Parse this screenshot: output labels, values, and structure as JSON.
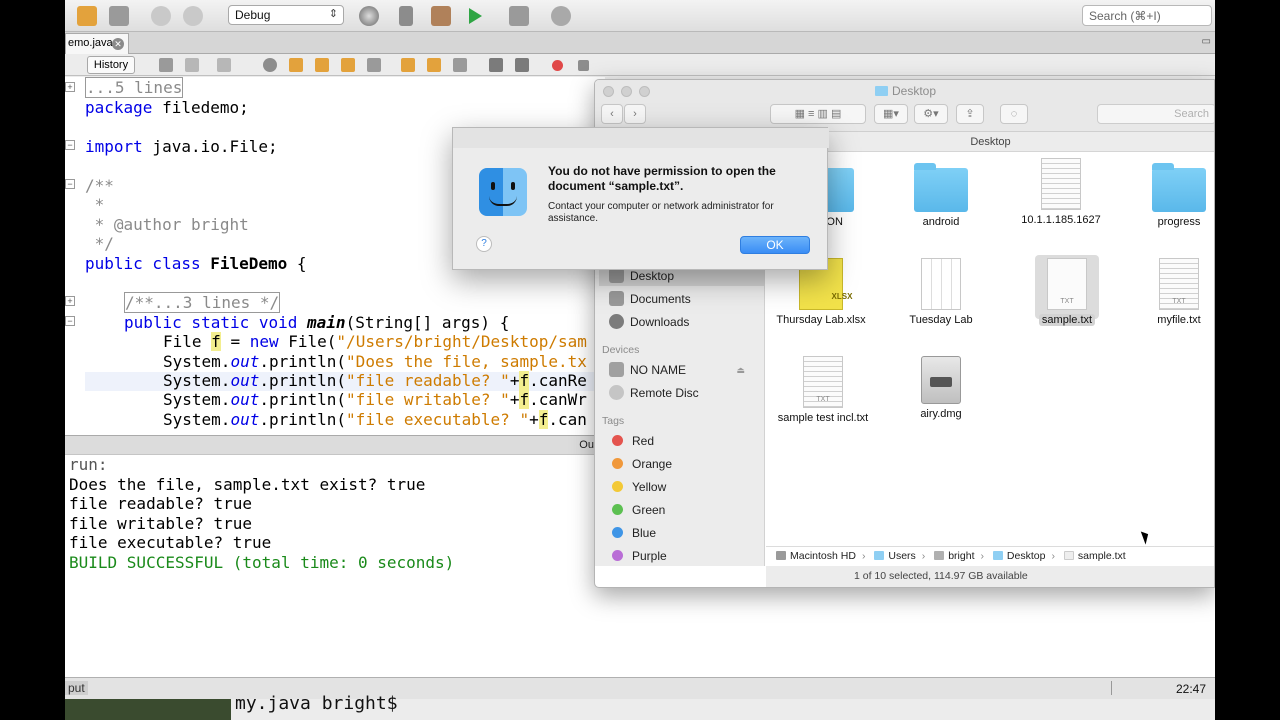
{
  "toolbar": {
    "config_select": "Debug",
    "search_placeholder": "Search (⌘+I)"
  },
  "editor": {
    "tab_label": "emo.java",
    "history_label": "History",
    "code": {
      "l1": "...5 lines",
      "l2_kw": "package",
      "l2_rest": " filedemo;",
      "l4_kw": "import",
      "l4_rest": " java.io.File;",
      "l6": "/**",
      "l7": " *",
      "l8": " * @author bright",
      "l9": " */",
      "l10_kw": "public class",
      "l10_name": "FileDemo",
      "l10_rest": " {",
      "l12": "/**...3 lines */",
      "l13_kw": "public static void",
      "l13_name": "main",
      "l13_rest": "(String[] args) {",
      "l14_a": "File ",
      "l14_var": "f",
      "l14_b": " = ",
      "l14_kw": "new",
      "l14_c": " File(",
      "l14_str": "\"/Users/bright/Desktop/sam",
      "l15_a": "System.",
      "l15_out": "out",
      "l15_b": ".println(",
      "l15_str": "\"Does the file, sample.tx",
      "l16_a": "System.",
      "l16_out": "out",
      "l16_b": ".println(",
      "l16_str": "\"file readable? \"",
      "l16_c": "+",
      "l16_var": "f",
      "l16_d": ".canRe",
      "l17_a": "System.",
      "l17_out": "out",
      "l17_b": ".println(",
      "l17_str": "\"file writable? \"",
      "l17_c": "+",
      "l17_var": "f",
      "l17_d": ".canWr",
      "l18_a": "System.",
      "l18_out": "out",
      "l18_b": ".println(",
      "l18_str": "\"file executable? \"",
      "l18_c": "+",
      "l18_var": "f",
      "l18_d": ".can"
    }
  },
  "output": {
    "header": "Out",
    "lines": [
      "run:",
      "Does the file, sample.txt exist? true",
      "file readable? true",
      "file writable? true",
      "file executable? true",
      "BUILD SUCCESSFUL (total time: 0 seconds)"
    ]
  },
  "status": {
    "left_label": "put",
    "time": "22:47",
    "terminal_peek": "my.java bright$"
  },
  "finder": {
    "title": "Desktop",
    "search_placeholder": "Search",
    "path_header": "Desktop",
    "sidebar": {
      "items": [
        "Desktop",
        "Documents",
        "Downloads"
      ],
      "devices_head": "Devices",
      "devices": [
        "NO NAME",
        "Remote Disc"
      ],
      "tags_head": "Tags",
      "tags": [
        {
          "name": "Red",
          "color": "#e4544e"
        },
        {
          "name": "Orange",
          "color": "#f0983b"
        },
        {
          "name": "Yellow",
          "color": "#f3c936"
        },
        {
          "name": "Green",
          "color": "#5cc051"
        },
        {
          "name": "Blue",
          "color": "#3f95e6"
        },
        {
          "name": "Purple",
          "color": "#b96dd6"
        }
      ]
    },
    "files": {
      "f1": "ANON",
      "f2": "android",
      "f3": "10.1.1.185.1627",
      "f4": "progress",
      "f5": "Thursday Lab.xlsx",
      "f6": "Tuesday Lab",
      "f7": "sample.txt",
      "f8": "myfile.txt",
      "f9": "sample test incl.txt",
      "f10": "airy.dmg",
      "ext_txt": "TXT",
      "ext_xlsx": "XLSX"
    },
    "path": {
      "hd": "Macintosh HD",
      "users": "Users",
      "bright": "bright",
      "desktop": "Desktop",
      "file": "sample.txt"
    },
    "status": "1 of 10 selected, 114.97 GB available"
  },
  "alert": {
    "title": "You do not have permission to open the document “sample.txt”.",
    "message": "Contact your computer or network administrator for assistance.",
    "help_label": "?",
    "ok_label": "OK"
  },
  "colors": {
    "accent_blue": "#3a8df5",
    "folder_blue": "#5ab8ea",
    "keyword": "#0000e6",
    "string": "#ce7b00",
    "build_success": "#1a8a1a"
  }
}
